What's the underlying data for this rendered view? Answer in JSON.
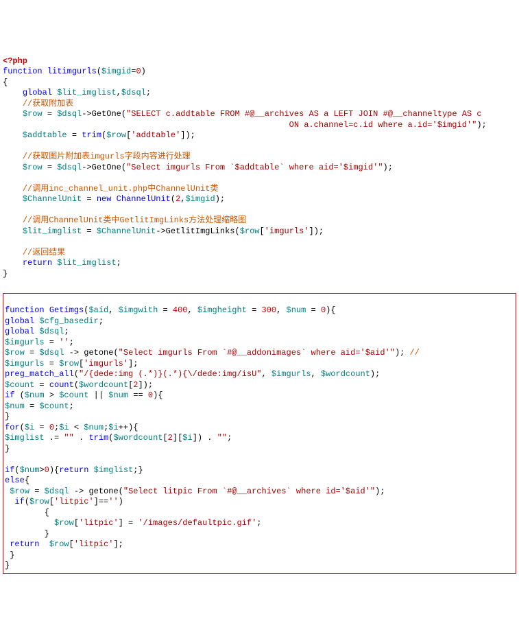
{
  "block1": {
    "l1": "<?php",
    "l2_kw": "function",
    "l2_fn": "litimgurls",
    "l2_var": "$imgid",
    "l2_num": "0",
    "l3": "{",
    "l4_kw": "global",
    "l4_v1": "$lit_imglist",
    "l4_v2": "$dsql",
    "l5_cmt": "//获取附加表",
    "l6_v1": "$row",
    "l6_v2": "$dsql",
    "l6_m": "GetOne",
    "l6_s1": "\"SELECT c.addtable FROM #@__archives AS a LEFT JOIN #@__channeltype AS c",
    "l7_s": "                                                          ON a.channel=c.id where a.id='$imgid'\"",
    "l8_v1": "$addtable",
    "l8_v2": "$row",
    "l8_key": "'addtable'",
    "l8_fn": "trim",
    "l10_cmt": "//获取图片附加表imgurls字段内容进行处理",
    "l11_v1": "$row",
    "l11_v2": "$dsql",
    "l11_m": "GetOne",
    "l11_s": "\"Select imgurls From `$addtable` where aid='$imgid'\"",
    "l13_cmt": "//调用inc_channel_unit.php中ChannelUnit类",
    "l14_v1": "$ChannelUnit",
    "l14_kw": "new",
    "l14_cls": "ChannelUnit",
    "l14_n1": "2",
    "l14_v2": "$imgid",
    "l16_cmt": "//调用ChannelUnit类中GetlitImgLinks方法处理缩略图",
    "l17_v1": "$lit_imglist",
    "l17_v2": "$ChannelUnit",
    "l17_m": "GetlitImgLinks",
    "l17_v3": "$row",
    "l17_key": "'imgurls'",
    "l19_cmt": "//返回结果",
    "l20_kw": "return",
    "l20_v": "$lit_imglist",
    "l21": "}"
  },
  "block2": {
    "l1_kw": "function",
    "l1_fn": "Getimgs",
    "l1_v1": "$aid",
    "l1_v2": "$imgwith",
    "l1_n2": "400",
    "l1_v3": "$imgheight",
    "l1_n3": "300",
    "l1_v4": "$num",
    "l1_n4": "0",
    "l2_kw": "global",
    "l2_v": "$cfg_basedir",
    "l3_kw": "global",
    "l3_v": "$dsql",
    "l4_v": "$imgurls",
    "l4_s": "''",
    "l5_v1": "$row",
    "l5_v2": "$dsql",
    "l5_m": "getone",
    "l5_s": "\"Select imgurls From `#@__addonimages` where aid='$aid'\"",
    "l5_cmt": "//",
    "l6_v1": "$imgurls",
    "l6_v2": "$row",
    "l6_key": "'imgurls'",
    "l7_fn": "preg_match_all",
    "l7_s": "\"/{dede:img (.*)}(.*){\\/dede:img/isU\"",
    "l7_v1": "$imgurls",
    "l7_v2": "$wordcount",
    "l8_v1": "$count",
    "l8_fn": "count",
    "l8_v2": "$wordcount",
    "l8_n": "2",
    "l9_kw": "if",
    "l9_v1": "$num",
    "l9_v2": "$count",
    "l9_v3": "$num",
    "l9_n": "0",
    "l10_v1": "$num",
    "l10_v2": "$count",
    "l11": "}",
    "l12_kw": "for",
    "l12_v1": "$i",
    "l12_n1": "0",
    "l12_v2": "$i",
    "l12_v3": "$num",
    "l12_v4": "$i",
    "l13_v1": "$imglist",
    "l13_s1": "\"\"",
    "l13_fn": "trim",
    "l13_v2": "$wordcount",
    "l13_n1": "2",
    "l13_v3": "$i",
    "l13_s2": "\"\"",
    "l14": "}",
    "l16_kw": "if",
    "l16_v": "$num",
    "l16_n": "0",
    "l16_kw2": "return",
    "l16_v2": "$imglist",
    "l17_kw": "else",
    "l18_v1": "$row",
    "l18_v2": "$dsql",
    "l18_m": "getone",
    "l18_s": "\"Select litpic From `#@__archives` where id='$aid'\"",
    "l19_kw": "if",
    "l19_v": "$row",
    "l19_key": "'litpic'",
    "l19_s": "''",
    "l20": "        {",
    "l21_v": "$row",
    "l21_key": "'litpic'",
    "l21_s": "'/images/defaultpic.gif'",
    "l22": "        }",
    "l23_kw": "return",
    "l23_v": "$row",
    "l23_key": "'litpic'",
    "l24": " }",
    "l25": "}"
  }
}
